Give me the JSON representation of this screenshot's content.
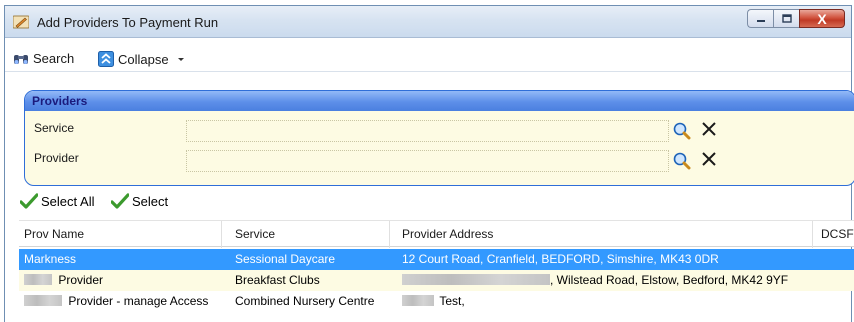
{
  "window": {
    "title": "Add Providers To Payment Run",
    "close_label": "X",
    "app_icon": "pen-icon",
    "minimize_icon": "minimize-icon",
    "maximize_icon": "maximize-icon"
  },
  "toolbar": {
    "search_label": "Search",
    "collapse_label": "Collapse"
  },
  "panel": {
    "title": "Providers",
    "fields": [
      {
        "label": "Service",
        "value": ""
      },
      {
        "label": "Provider",
        "value": ""
      }
    ]
  },
  "selection": {
    "select_all_label": "Select All",
    "select_label": "Select"
  },
  "grid": {
    "columns": [
      "Prov Name",
      "Service",
      "Provider Address",
      "DCSF"
    ],
    "rows": [
      {
        "name": "Markness",
        "service": "Sessional Daycare",
        "address": "12 Court Road, Cranfield, BEDFORD, Simshire, MK43 0DR",
        "selected": true
      },
      {
        "name": "Provider",
        "service": "Breakfast Clubs",
        "address": ", Wilstead Road, Elstow, Bedford, MK42 9YF",
        "selected": false
      },
      {
        "name": "Provider - manage Access",
        "service": "Combined Nursery Centre",
        "address": "Test,",
        "selected": false
      }
    ]
  },
  "colors": {
    "selected_row": "#3399ff",
    "panel_header": "#5d8fe9",
    "panel_background": "#fdfbe3",
    "close_button": "#c03a25"
  }
}
